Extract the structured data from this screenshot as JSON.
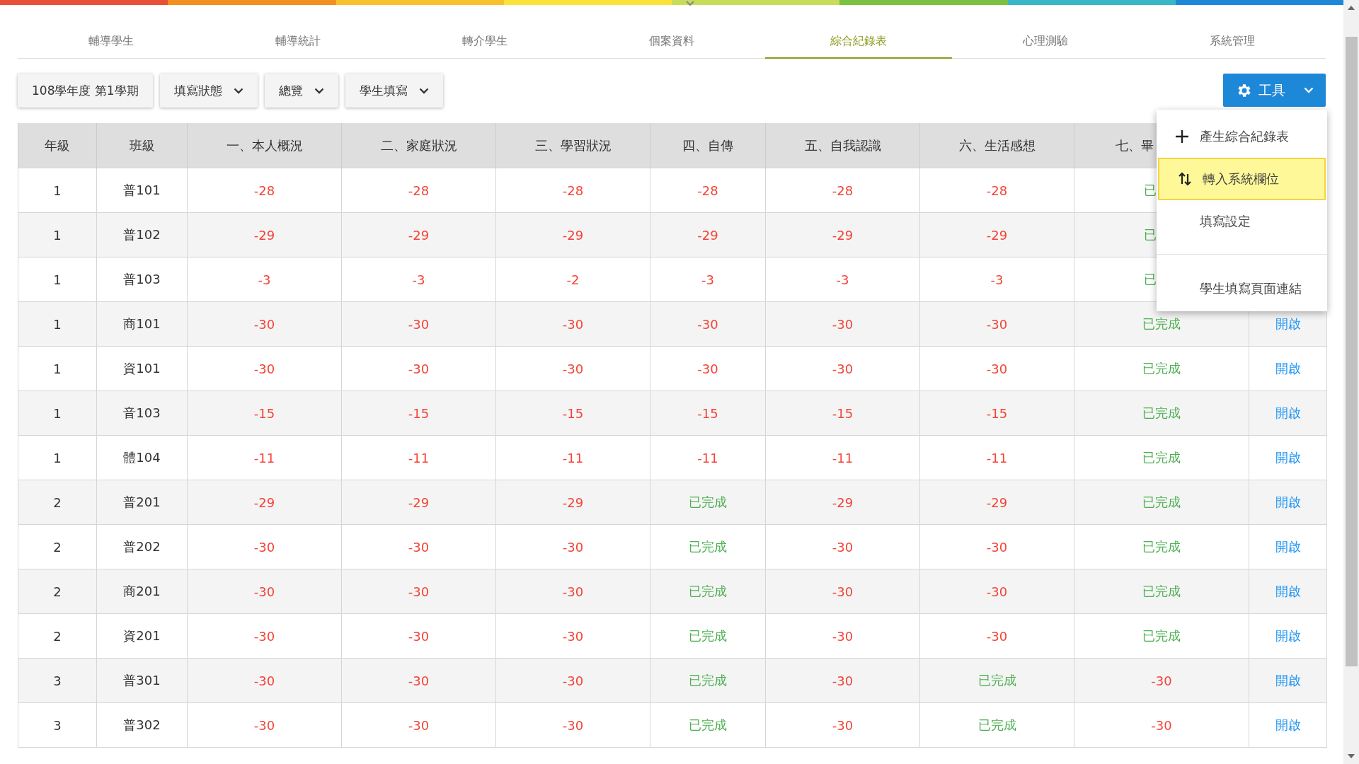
{
  "tabs": [
    {
      "label": "輔導學生",
      "selected": false
    },
    {
      "label": "輔導統計",
      "selected": false
    },
    {
      "label": "轉介學生",
      "selected": false
    },
    {
      "label": "個案資料",
      "selected": false
    },
    {
      "label": "綜合紀錄表",
      "selected": true
    },
    {
      "label": "心理測驗",
      "selected": false
    },
    {
      "label": "系統管理",
      "selected": false
    }
  ],
  "filters": [
    {
      "label": "108學年度 第1學期",
      "kind": "term"
    },
    {
      "label": "填寫狀態",
      "kind": "dropdown"
    },
    {
      "label": "總覽",
      "kind": "dropdown"
    },
    {
      "label": "學生填寫",
      "kind": "dropdown"
    }
  ],
  "tools": {
    "label": "工具",
    "expanded": true,
    "menu": [
      {
        "label": "產生綜合紀錄表",
        "kind": "add",
        "selected": false
      },
      {
        "label": "轉入系統欄位",
        "kind": "import",
        "selected": true
      },
      {
        "label": "填寫設定",
        "kind": "plain",
        "selected": false
      },
      {
        "kind": "divider"
      },
      {
        "label": "學生填寫頁面連結",
        "kind": "plain",
        "selected": false
      }
    ]
  },
  "table": {
    "columns": [
      {
        "label": "年級"
      },
      {
        "label": "班級"
      },
      {
        "label": "一、本人概況"
      },
      {
        "label": "二、家庭狀況"
      },
      {
        "label": "三、學習狀況"
      },
      {
        "label": "四、自傳"
      },
      {
        "label": "五、自我認識"
      },
      {
        "label": "六、生活感想"
      },
      {
        "label": "七、畢",
        "clipped": true
      },
      {}
    ],
    "rows": [
      [
        {
          "text": "1"
        },
        {
          "text": "普101"
        },
        {
          "text": "-28",
          "kind": "todo"
        },
        {
          "text": "-28",
          "kind": "todo"
        },
        {
          "text": "-28",
          "kind": "todo"
        },
        {
          "text": "-28",
          "kind": "todo"
        },
        {
          "text": "-28",
          "kind": "todo"
        },
        {
          "text": "-28",
          "kind": "todo"
        },
        {
          "text": "已",
          "kind": "done",
          "clipped": true
        },
        {}
      ],
      [
        {
          "text": "1"
        },
        {
          "text": "普102"
        },
        {
          "text": "-29",
          "kind": "todo"
        },
        {
          "text": "-29",
          "kind": "todo"
        },
        {
          "text": "-29",
          "kind": "todo"
        },
        {
          "text": "-29",
          "kind": "todo"
        },
        {
          "text": "-29",
          "kind": "todo"
        },
        {
          "text": "-29",
          "kind": "todo"
        },
        {
          "text": "已",
          "kind": "done",
          "clipped": true
        },
        {}
      ],
      [
        {
          "text": "1"
        },
        {
          "text": "普103"
        },
        {
          "text": "-3",
          "kind": "todo"
        },
        {
          "text": "-3",
          "kind": "todo"
        },
        {
          "text": "-2",
          "kind": "todo"
        },
        {
          "text": "-3",
          "kind": "todo"
        },
        {
          "text": "-3",
          "kind": "todo"
        },
        {
          "text": "-3",
          "kind": "todo"
        },
        {
          "text": "已",
          "kind": "done",
          "clipped": true
        },
        {}
      ],
      [
        {
          "text": "1"
        },
        {
          "text": "商101"
        },
        {
          "text": "-30",
          "kind": "todo"
        },
        {
          "text": "-30",
          "kind": "todo"
        },
        {
          "text": "-30",
          "kind": "todo"
        },
        {
          "text": "-30",
          "kind": "todo"
        },
        {
          "text": "-30",
          "kind": "todo"
        },
        {
          "text": "-30",
          "kind": "todo"
        },
        {
          "text": "已完成",
          "kind": "done"
        },
        {
          "text": "開啟",
          "kind": "link"
        }
      ],
      [
        {
          "text": "1"
        },
        {
          "text": "資101"
        },
        {
          "text": "-30",
          "kind": "todo"
        },
        {
          "text": "-30",
          "kind": "todo"
        },
        {
          "text": "-30",
          "kind": "todo"
        },
        {
          "text": "-30",
          "kind": "todo"
        },
        {
          "text": "-30",
          "kind": "todo"
        },
        {
          "text": "-30",
          "kind": "todo"
        },
        {
          "text": "已完成",
          "kind": "done"
        },
        {
          "text": "開啟",
          "kind": "link"
        }
      ],
      [
        {
          "text": "1"
        },
        {
          "text": "音103"
        },
        {
          "text": "-15",
          "kind": "todo"
        },
        {
          "text": "-15",
          "kind": "todo"
        },
        {
          "text": "-15",
          "kind": "todo"
        },
        {
          "text": "-15",
          "kind": "todo"
        },
        {
          "text": "-15",
          "kind": "todo"
        },
        {
          "text": "-15",
          "kind": "todo"
        },
        {
          "text": "已完成",
          "kind": "done"
        },
        {
          "text": "開啟",
          "kind": "link"
        }
      ],
      [
        {
          "text": "1"
        },
        {
          "text": "體104"
        },
        {
          "text": "-11",
          "kind": "todo"
        },
        {
          "text": "-11",
          "kind": "todo"
        },
        {
          "text": "-11",
          "kind": "todo"
        },
        {
          "text": "-11",
          "kind": "todo"
        },
        {
          "text": "-11",
          "kind": "todo"
        },
        {
          "text": "-11",
          "kind": "todo"
        },
        {
          "text": "已完成",
          "kind": "done"
        },
        {
          "text": "開啟",
          "kind": "link"
        }
      ],
      [
        {
          "text": "2"
        },
        {
          "text": "普201"
        },
        {
          "text": "-29",
          "kind": "todo"
        },
        {
          "text": "-29",
          "kind": "todo"
        },
        {
          "text": "-29",
          "kind": "todo"
        },
        {
          "text": "已完成",
          "kind": "done"
        },
        {
          "text": "-29",
          "kind": "todo"
        },
        {
          "text": "-29",
          "kind": "todo"
        },
        {
          "text": "已完成",
          "kind": "done"
        },
        {
          "text": "開啟",
          "kind": "link"
        }
      ],
      [
        {
          "text": "2"
        },
        {
          "text": "普202"
        },
        {
          "text": "-30",
          "kind": "todo"
        },
        {
          "text": "-30",
          "kind": "todo"
        },
        {
          "text": "-30",
          "kind": "todo"
        },
        {
          "text": "已完成",
          "kind": "done"
        },
        {
          "text": "-30",
          "kind": "todo"
        },
        {
          "text": "-30",
          "kind": "todo"
        },
        {
          "text": "已完成",
          "kind": "done"
        },
        {
          "text": "開啟",
          "kind": "link"
        }
      ],
      [
        {
          "text": "2"
        },
        {
          "text": "商201"
        },
        {
          "text": "-30",
          "kind": "todo"
        },
        {
          "text": "-30",
          "kind": "todo"
        },
        {
          "text": "-30",
          "kind": "todo"
        },
        {
          "text": "已完成",
          "kind": "done"
        },
        {
          "text": "-30",
          "kind": "todo"
        },
        {
          "text": "-30",
          "kind": "todo"
        },
        {
          "text": "已完成",
          "kind": "done"
        },
        {
          "text": "開啟",
          "kind": "link"
        }
      ],
      [
        {
          "text": "2"
        },
        {
          "text": "資201"
        },
        {
          "text": "-30",
          "kind": "todo"
        },
        {
          "text": "-30",
          "kind": "todo"
        },
        {
          "text": "-30",
          "kind": "todo"
        },
        {
          "text": "已完成",
          "kind": "done"
        },
        {
          "text": "-30",
          "kind": "todo"
        },
        {
          "text": "-30",
          "kind": "todo"
        },
        {
          "text": "已完成",
          "kind": "done"
        },
        {
          "text": "開啟",
          "kind": "link"
        }
      ],
      [
        {
          "text": "3"
        },
        {
          "text": "普301"
        },
        {
          "text": "-30",
          "kind": "todo"
        },
        {
          "text": "-30",
          "kind": "todo"
        },
        {
          "text": "-30",
          "kind": "todo"
        },
        {
          "text": "已完成",
          "kind": "done"
        },
        {
          "text": "-30",
          "kind": "todo"
        },
        {
          "text": "已完成",
          "kind": "done"
        },
        {
          "text": "-30",
          "kind": "todo"
        },
        {
          "text": "開啟",
          "kind": "link"
        }
      ],
      [
        {
          "text": "3"
        },
        {
          "text": "普302"
        },
        {
          "text": "-30",
          "kind": "todo"
        },
        {
          "text": "-30",
          "kind": "todo"
        },
        {
          "text": "-30",
          "kind": "todo"
        },
        {
          "text": "已完成",
          "kind": "done"
        },
        {
          "text": "-30",
          "kind": "todo"
        },
        {
          "text": "已完成",
          "kind": "done"
        },
        {
          "text": "-30",
          "kind": "todo"
        },
        {
          "text": "開啟",
          "kind": "link"
        }
      ]
    ]
  }
}
